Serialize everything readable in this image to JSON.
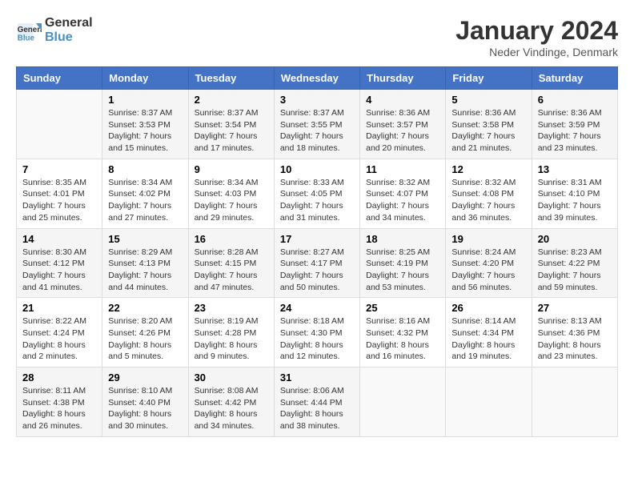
{
  "header": {
    "logo_line1": "General",
    "logo_line2": "Blue",
    "month_title": "January 2024",
    "location": "Neder Vindinge, Denmark"
  },
  "weekdays": [
    "Sunday",
    "Monday",
    "Tuesday",
    "Wednesday",
    "Thursday",
    "Friday",
    "Saturday"
  ],
  "weeks": [
    [
      {
        "day": "",
        "sunrise": "",
        "sunset": "",
        "daylight": ""
      },
      {
        "day": "1",
        "sunrise": "Sunrise: 8:37 AM",
        "sunset": "Sunset: 3:53 PM",
        "daylight": "Daylight: 7 hours and 15 minutes."
      },
      {
        "day": "2",
        "sunrise": "Sunrise: 8:37 AM",
        "sunset": "Sunset: 3:54 PM",
        "daylight": "Daylight: 7 hours and 17 minutes."
      },
      {
        "day": "3",
        "sunrise": "Sunrise: 8:37 AM",
        "sunset": "Sunset: 3:55 PM",
        "daylight": "Daylight: 7 hours and 18 minutes."
      },
      {
        "day": "4",
        "sunrise": "Sunrise: 8:36 AM",
        "sunset": "Sunset: 3:57 PM",
        "daylight": "Daylight: 7 hours and 20 minutes."
      },
      {
        "day": "5",
        "sunrise": "Sunrise: 8:36 AM",
        "sunset": "Sunset: 3:58 PM",
        "daylight": "Daylight: 7 hours and 21 minutes."
      },
      {
        "day": "6",
        "sunrise": "Sunrise: 8:36 AM",
        "sunset": "Sunset: 3:59 PM",
        "daylight": "Daylight: 7 hours and 23 minutes."
      }
    ],
    [
      {
        "day": "7",
        "sunrise": "Sunrise: 8:35 AM",
        "sunset": "Sunset: 4:01 PM",
        "daylight": "Daylight: 7 hours and 25 minutes."
      },
      {
        "day": "8",
        "sunrise": "Sunrise: 8:34 AM",
        "sunset": "Sunset: 4:02 PM",
        "daylight": "Daylight: 7 hours and 27 minutes."
      },
      {
        "day": "9",
        "sunrise": "Sunrise: 8:34 AM",
        "sunset": "Sunset: 4:03 PM",
        "daylight": "Daylight: 7 hours and 29 minutes."
      },
      {
        "day": "10",
        "sunrise": "Sunrise: 8:33 AM",
        "sunset": "Sunset: 4:05 PM",
        "daylight": "Daylight: 7 hours and 31 minutes."
      },
      {
        "day": "11",
        "sunrise": "Sunrise: 8:32 AM",
        "sunset": "Sunset: 4:07 PM",
        "daylight": "Daylight: 7 hours and 34 minutes."
      },
      {
        "day": "12",
        "sunrise": "Sunrise: 8:32 AM",
        "sunset": "Sunset: 4:08 PM",
        "daylight": "Daylight: 7 hours and 36 minutes."
      },
      {
        "day": "13",
        "sunrise": "Sunrise: 8:31 AM",
        "sunset": "Sunset: 4:10 PM",
        "daylight": "Daylight: 7 hours and 39 minutes."
      }
    ],
    [
      {
        "day": "14",
        "sunrise": "Sunrise: 8:30 AM",
        "sunset": "Sunset: 4:12 PM",
        "daylight": "Daylight: 7 hours and 41 minutes."
      },
      {
        "day": "15",
        "sunrise": "Sunrise: 8:29 AM",
        "sunset": "Sunset: 4:13 PM",
        "daylight": "Daylight: 7 hours and 44 minutes."
      },
      {
        "day": "16",
        "sunrise": "Sunrise: 8:28 AM",
        "sunset": "Sunset: 4:15 PM",
        "daylight": "Daylight: 7 hours and 47 minutes."
      },
      {
        "day": "17",
        "sunrise": "Sunrise: 8:27 AM",
        "sunset": "Sunset: 4:17 PM",
        "daylight": "Daylight: 7 hours and 50 minutes."
      },
      {
        "day": "18",
        "sunrise": "Sunrise: 8:25 AM",
        "sunset": "Sunset: 4:19 PM",
        "daylight": "Daylight: 7 hours and 53 minutes."
      },
      {
        "day": "19",
        "sunrise": "Sunrise: 8:24 AM",
        "sunset": "Sunset: 4:20 PM",
        "daylight": "Daylight: 7 hours and 56 minutes."
      },
      {
        "day": "20",
        "sunrise": "Sunrise: 8:23 AM",
        "sunset": "Sunset: 4:22 PM",
        "daylight": "Daylight: 7 hours and 59 minutes."
      }
    ],
    [
      {
        "day": "21",
        "sunrise": "Sunrise: 8:22 AM",
        "sunset": "Sunset: 4:24 PM",
        "daylight": "Daylight: 8 hours and 2 minutes."
      },
      {
        "day": "22",
        "sunrise": "Sunrise: 8:20 AM",
        "sunset": "Sunset: 4:26 PM",
        "daylight": "Daylight: 8 hours and 5 minutes."
      },
      {
        "day": "23",
        "sunrise": "Sunrise: 8:19 AM",
        "sunset": "Sunset: 4:28 PM",
        "daylight": "Daylight: 8 hours and 9 minutes."
      },
      {
        "day": "24",
        "sunrise": "Sunrise: 8:18 AM",
        "sunset": "Sunset: 4:30 PM",
        "daylight": "Daylight: 8 hours and 12 minutes."
      },
      {
        "day": "25",
        "sunrise": "Sunrise: 8:16 AM",
        "sunset": "Sunset: 4:32 PM",
        "daylight": "Daylight: 8 hours and 16 minutes."
      },
      {
        "day": "26",
        "sunrise": "Sunrise: 8:14 AM",
        "sunset": "Sunset: 4:34 PM",
        "daylight": "Daylight: 8 hours and 19 minutes."
      },
      {
        "day": "27",
        "sunrise": "Sunrise: 8:13 AM",
        "sunset": "Sunset: 4:36 PM",
        "daylight": "Daylight: 8 hours and 23 minutes."
      }
    ],
    [
      {
        "day": "28",
        "sunrise": "Sunrise: 8:11 AM",
        "sunset": "Sunset: 4:38 PM",
        "daylight": "Daylight: 8 hours and 26 minutes."
      },
      {
        "day": "29",
        "sunrise": "Sunrise: 8:10 AM",
        "sunset": "Sunset: 4:40 PM",
        "daylight": "Daylight: 8 hours and 30 minutes."
      },
      {
        "day": "30",
        "sunrise": "Sunrise: 8:08 AM",
        "sunset": "Sunset: 4:42 PM",
        "daylight": "Daylight: 8 hours and 34 minutes."
      },
      {
        "day": "31",
        "sunrise": "Sunrise: 8:06 AM",
        "sunset": "Sunset: 4:44 PM",
        "daylight": "Daylight: 8 hours and 38 minutes."
      },
      {
        "day": "",
        "sunrise": "",
        "sunset": "",
        "daylight": ""
      },
      {
        "day": "",
        "sunrise": "",
        "sunset": "",
        "daylight": ""
      },
      {
        "day": "",
        "sunrise": "",
        "sunset": "",
        "daylight": ""
      }
    ]
  ]
}
